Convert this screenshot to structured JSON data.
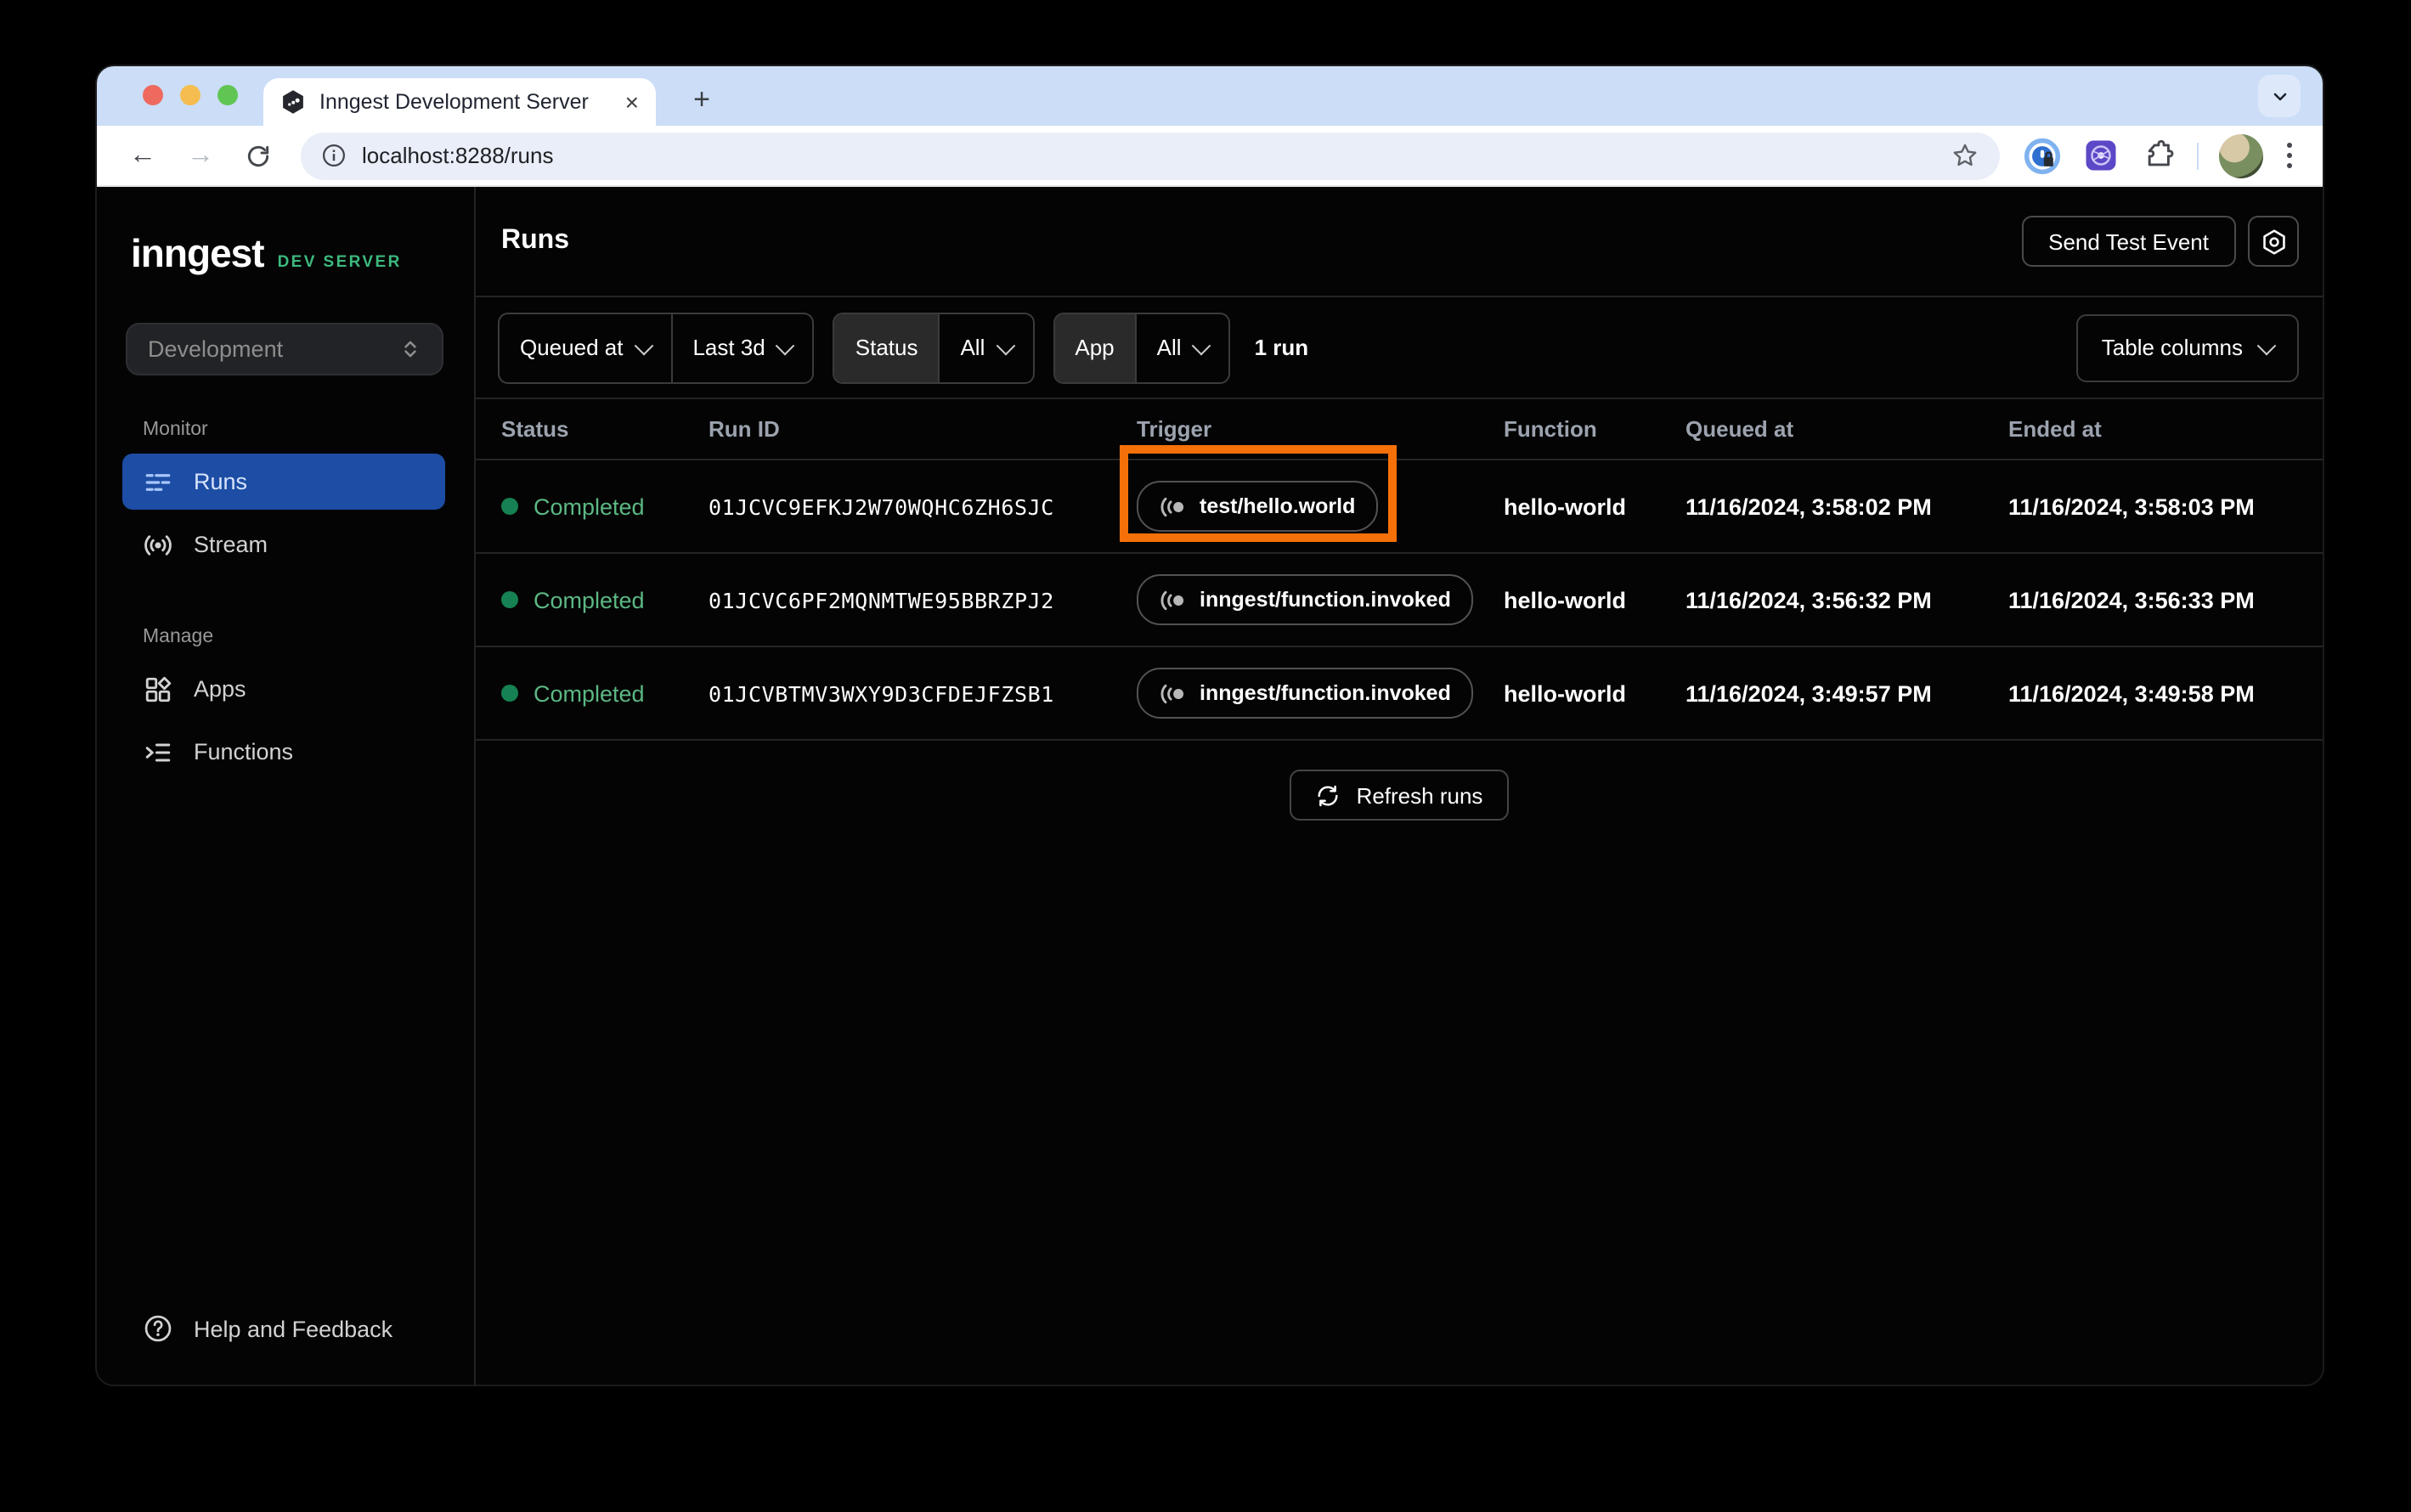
{
  "browser": {
    "tab_title": "Inngest Development Server",
    "url": "localhost:8288/runs",
    "close_tab_glyph": "×",
    "new_tab_glyph": "+"
  },
  "sidebar": {
    "logo": "inngest",
    "logo_badge": "DEV SERVER",
    "env_selector_value": "Development",
    "monitor_label": "Monitor",
    "manage_label": "Manage",
    "items": [
      {
        "label": "Runs",
        "active": true
      },
      {
        "label": "Stream",
        "active": false
      },
      {
        "label": "Apps",
        "active": false
      },
      {
        "label": "Functions",
        "active": false
      }
    ],
    "help_label": "Help and Feedback"
  },
  "header": {
    "title": "Runs",
    "send_test_event_label": "Send Test Event"
  },
  "filters": {
    "queued_at_label": "Queued at",
    "time_range_value": "Last 3d",
    "status_label": "Status",
    "status_value": "All",
    "app_label": "App",
    "app_value": "All",
    "run_count": "1 run",
    "table_columns_label": "Table columns"
  },
  "table": {
    "columns": [
      "Status",
      "Run ID",
      "Trigger",
      "Function",
      "Queued at",
      "Ended at"
    ],
    "rows": [
      {
        "status": "Completed",
        "run_id": "01JCVC9EFKJ2W70WQHC6ZH6SJC",
        "trigger": "test/hello.world",
        "function": "hello-world",
        "queued_at": "11/16/2024, 3:58:02 PM",
        "ended_at": "11/16/2024, 3:58:03 PM",
        "highlighted": true
      },
      {
        "status": "Completed",
        "run_id": "01JCVC6PF2MQNMTWE95BBRZPJ2",
        "trigger": "inngest/function.invoked",
        "function": "hello-world",
        "queued_at": "11/16/2024, 3:56:32 PM",
        "ended_at": "11/16/2024, 3:56:33 PM",
        "highlighted": false
      },
      {
        "status": "Completed",
        "run_id": "01JCVBTMV3WXY9D3CFDEJFZSB1",
        "trigger": "inngest/function.invoked",
        "function": "hello-world",
        "queued_at": "11/16/2024, 3:49:57 PM",
        "ended_at": "11/16/2024, 3:49:58 PM",
        "highlighted": false
      }
    ],
    "refresh_label": "Refresh runs"
  },
  "colors": {
    "accent_blue": "#1d4da4",
    "status_dot_green": "#168152",
    "status_text_green": "#5cb884",
    "dev_server_green": "#3db97e",
    "highlight_orange": "#f57009",
    "tabstrip_blue": "#cbddf7"
  }
}
